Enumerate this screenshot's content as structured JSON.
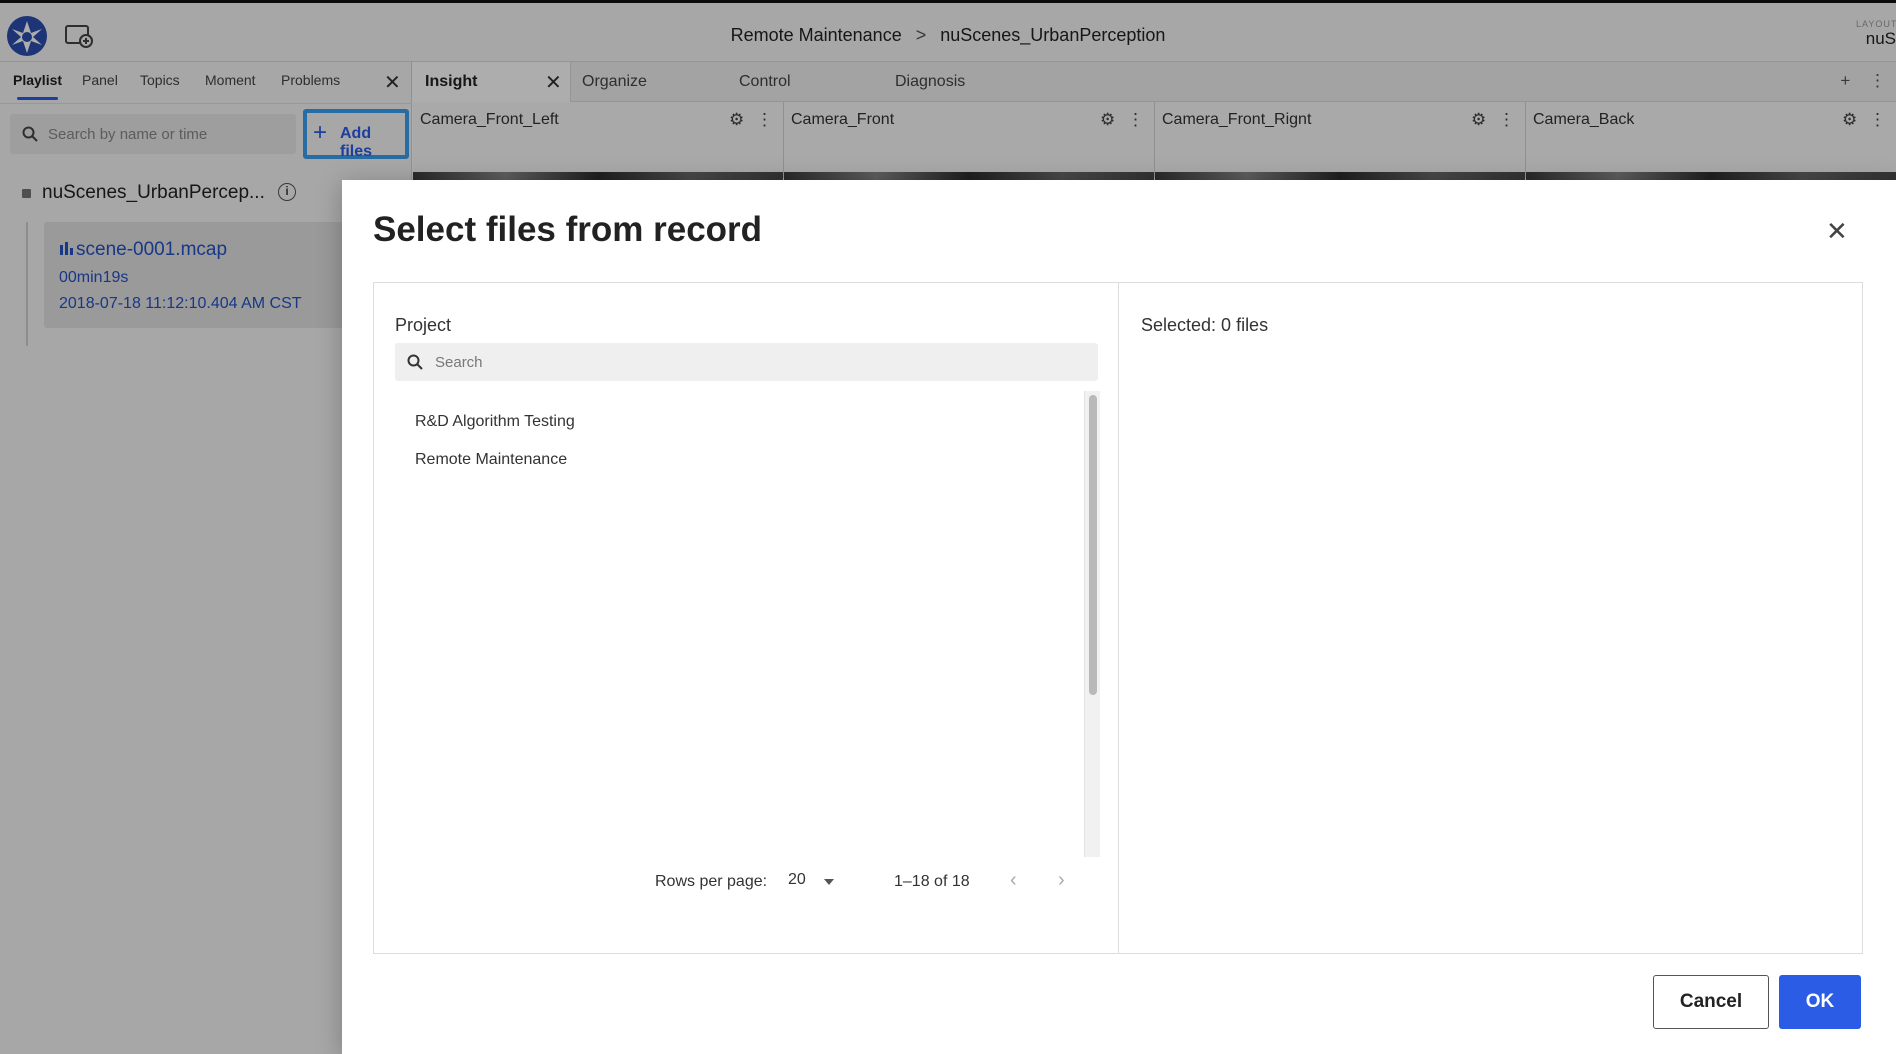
{
  "topbar": {
    "breadcrumb_project": "Remote Maintenance",
    "breadcrumb_separator": ">",
    "breadcrumb_record": "nuScenes_UrbanPerception",
    "layout_label": "LAYOUT",
    "layout_value": "nuS"
  },
  "sidebar": {
    "tabs": [
      "Playlist",
      "Panel",
      "Topics",
      "Moment",
      "Problems"
    ],
    "active_tab": "Playlist",
    "search_placeholder": "Search by name or time",
    "add_files_label": "Add files",
    "record_name": "nuScenes_UrbanPercep...",
    "file": {
      "name": "scene-0001.mcap",
      "duration": "00min19s",
      "timestamp": "2018-07-18 11:12:10.404 AM CST"
    }
  },
  "main": {
    "tabs": [
      "Insight",
      "Organize",
      "Control",
      "Diagnosis"
    ],
    "active_tab": "Insight",
    "panels": [
      "Camera_Front_Left",
      "Camera_Front",
      "Camera_Front_Rignt",
      "Camera_Back"
    ]
  },
  "modal": {
    "title": "Select files from record",
    "project_label": "Project",
    "search_placeholder": "Search",
    "projects": [
      "R&D Algorithm Testing",
      "Remote Maintenance"
    ],
    "rows_per_page_label": "Rows per page:",
    "rows_per_page_value": "20",
    "page_range": "1–18 of 18",
    "selected_label": "Selected: 0 files",
    "cancel_label": "Cancel",
    "ok_label": "OK"
  },
  "colors": {
    "accent": "#2b5ce6",
    "highlight": "#3aa0ef",
    "link": "#2451c8"
  },
  "icons": {
    "logo": "app-logo",
    "new_window": "new-window-icon",
    "search": "search-icon",
    "info": "info-icon",
    "close": "close-icon",
    "gear": "gear-icon",
    "more": "more-vertical-icon",
    "chevron_left": "chevron-left-icon",
    "chevron_right": "chevron-right-icon"
  }
}
